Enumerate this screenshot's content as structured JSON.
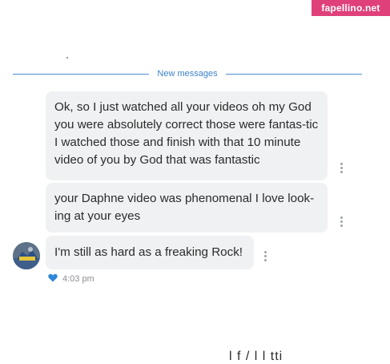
{
  "watermark": {
    "text": "fapellino.net",
    "color": "#e0407a"
  },
  "divider": {
    "label": "New messages",
    "color": "#3b82c8"
  },
  "messages": [
    {
      "text": "Ok, so I just watched all your videos oh my God you were absolutely correct those were fantas-tic I watched those and finish with that 10 minute video of you by God that was fantastic"
    },
    {
      "text": "your Daphne video was phenomenal I love look-ing at your eyes"
    },
    {
      "text": "I'm still as hard as a freaking Rock!"
    }
  ],
  "status": {
    "time": "4:03 pm",
    "icon": "heart-icon",
    "icon_color": "#2f87d8"
  },
  "bubble_color": "#f0f1f3",
  "bottom_fragment": "l  f     /  l  l  tti"
}
